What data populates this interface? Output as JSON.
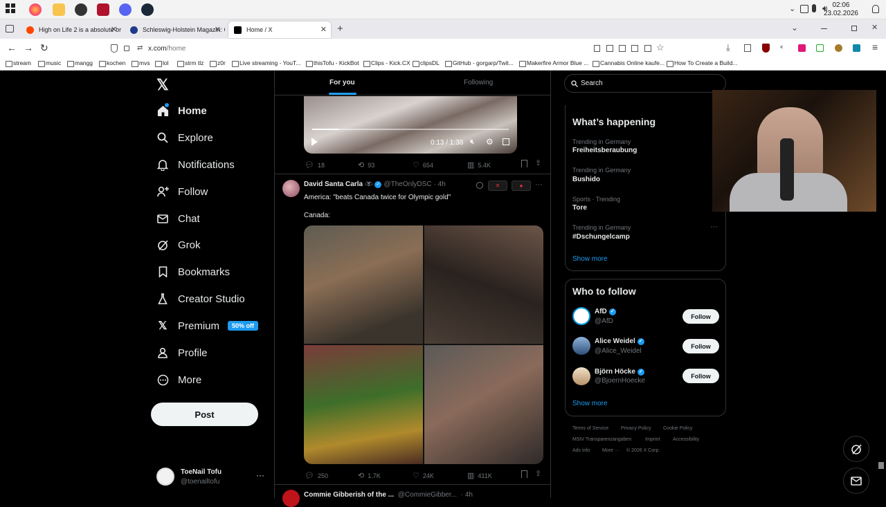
{
  "taskbar": {
    "time": "02:06",
    "date": "23.02.2026"
  },
  "tabs": [
    {
      "title": "High on Life 2 is a absolute bro"
    },
    {
      "title": "Schleswig-Holstein Magazin: Gi"
    },
    {
      "title": "Home / X"
    }
  ],
  "address": {
    "url": "x.com/home",
    "url_host": "x.com",
    "url_path": "/home"
  },
  "bookmarks": [
    "stream",
    "music",
    "mangg",
    "kochen",
    "mvs",
    "lol",
    "strm tlz",
    "z0r",
    "Live streaming - YouT...",
    "thisTofu - KickBot",
    "Clips - Kick.CX",
    "clipsDL",
    "GitHub - gorgarp/Twit...",
    "Makerfire Armor Blue ...",
    "Cannabis Online kaufe...",
    "How To Create a Build..."
  ],
  "nav": {
    "items": [
      "Home",
      "Explore",
      "Notifications",
      "Follow",
      "Chat",
      "Grok",
      "Bookmarks",
      "Creator Studio",
      "Premium",
      "Profile",
      "More"
    ],
    "premium_badge": "50% off",
    "post_label": "Post"
  },
  "account": {
    "name": "ToeNail Tofu",
    "handle": "@toenailtofu"
  },
  "feed_tabs": {
    "for_you": "For you",
    "following": "Following"
  },
  "video": {
    "time": "0:13 / 1:38"
  },
  "post1_stats": {
    "replies": "18",
    "reposts": "93",
    "likes": "654",
    "views": "5.4K"
  },
  "post2": {
    "author": "David Santa Carla",
    "handle": "@TheOnlyDSC",
    "age": "· 4h",
    "line1": "America: \"beats Canada twice for Olympic gold\"",
    "line2": "Canada:",
    "stats": {
      "replies": "250",
      "reposts": "1.7K",
      "likes": "24K",
      "views": "411K"
    }
  },
  "post3": {
    "author": "Commie Gibberish of the ...",
    "handle": "@CommieGibber...",
    "age": "· 4h"
  },
  "search": {
    "placeholder": "Search"
  },
  "trends": {
    "title": "What’s happening",
    "items": [
      {
        "category": "Trending in Germany",
        "name": "Freiheitsberaubung"
      },
      {
        "category": "Trending in Germany",
        "name": "Bushido"
      },
      {
        "category": "Sports · Trending",
        "name": "Tore"
      },
      {
        "category": "Trending in Germany",
        "name": "#Dschungelcamp"
      }
    ],
    "show_more": "Show more"
  },
  "who_to_follow": {
    "title": "Who to follow",
    "items": [
      {
        "name": "AfD",
        "handle": "@AfD"
      },
      {
        "name": "Alice Weidel",
        "handle": "@Alice_Weidel"
      },
      {
        "name": "Björn Höcke",
        "handle": "@BjoernHoecke"
      }
    ],
    "follow_label": "Follow",
    "show_more": "Show more"
  },
  "footer": [
    "Terms of Service",
    "Privacy Policy",
    "Cookie Policy",
    "MStV Transparenzangaben",
    "Imprint",
    "Accessibility",
    "Ads info",
    "More ···",
    "© 2026 X Corp."
  ],
  "colors": {
    "accent": "#1d9bf0",
    "bg": "#000000",
    "border": "#2f3336",
    "muted": "#71767b"
  }
}
